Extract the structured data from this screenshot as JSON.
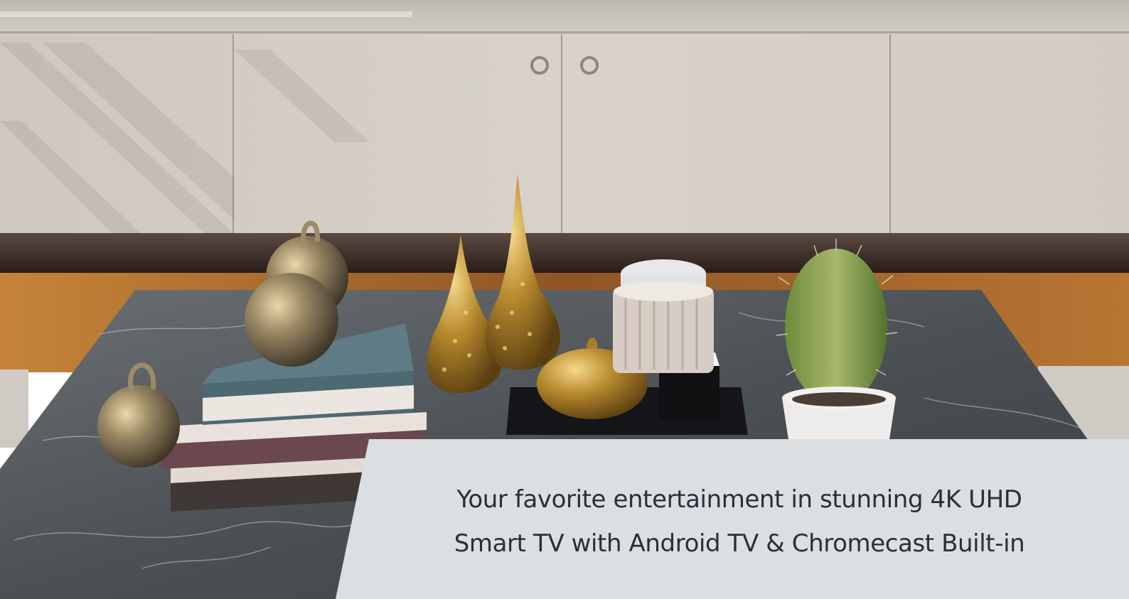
{
  "hero": {
    "caption_line_1": "Your favorite entertainment in stunning 4K UHD",
    "caption_line_2": "Smart TV with Android TV & Chromecast Built-in"
  },
  "colors": {
    "caption_panel": "#dcdfe2",
    "caption_text": "#26303d",
    "cabinet": "#d4cdc6",
    "marble": "#4e5357",
    "floor": "#b06e2f"
  }
}
